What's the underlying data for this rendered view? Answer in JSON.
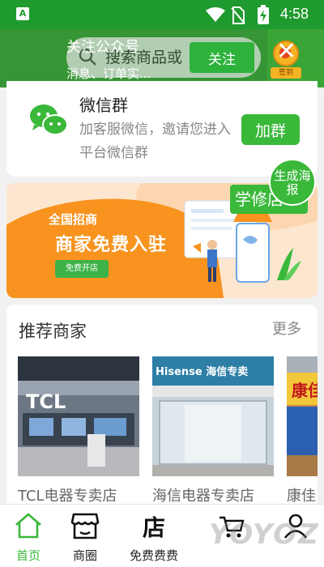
{
  "status_bar": {
    "app_badge": "A",
    "time": "4:58"
  },
  "header": {
    "search_placeholder": "搜索商品或",
    "follow_title": "关注公众号",
    "follow_subtitle": "消息、订单实...",
    "follow_button": "关注",
    "checkin_label": "签到"
  },
  "wechat_group": {
    "title": "微信群",
    "description": "加客服微信，邀请您进入平台微信群",
    "join_button": "加群"
  },
  "banner": {
    "small_text": "全国招商",
    "big_text": "商家免费入驻",
    "button_text": "免费开店"
  },
  "study_tag": "学修店",
  "poster_button": "生成海报",
  "recommended": {
    "title": "推荐商家",
    "more": "更多",
    "shops": [
      {
        "name": "TCL电器专卖店",
        "sign": "TCL"
      },
      {
        "name": "海信电器专卖店",
        "sign": "Hisense 海信专卖"
      },
      {
        "name": "康佳",
        "sign": "康佳"
      }
    ]
  },
  "bottom_nav": {
    "items": [
      {
        "label": "首页",
        "icon": "home-icon"
      },
      {
        "label": "商圈",
        "icon": "store-icon"
      },
      {
        "label": "免费费费",
        "icon": "shop-sign-icon"
      },
      {
        "label": "",
        "icon": "cart-icon"
      },
      {
        "label": "",
        "icon": "user-icon"
      }
    ]
  },
  "watermark": "YOYOZ",
  "colors": {
    "primary_green": "#3ab83a",
    "status_green": "#1f9a2e",
    "banner_orange": "#f7931e"
  }
}
